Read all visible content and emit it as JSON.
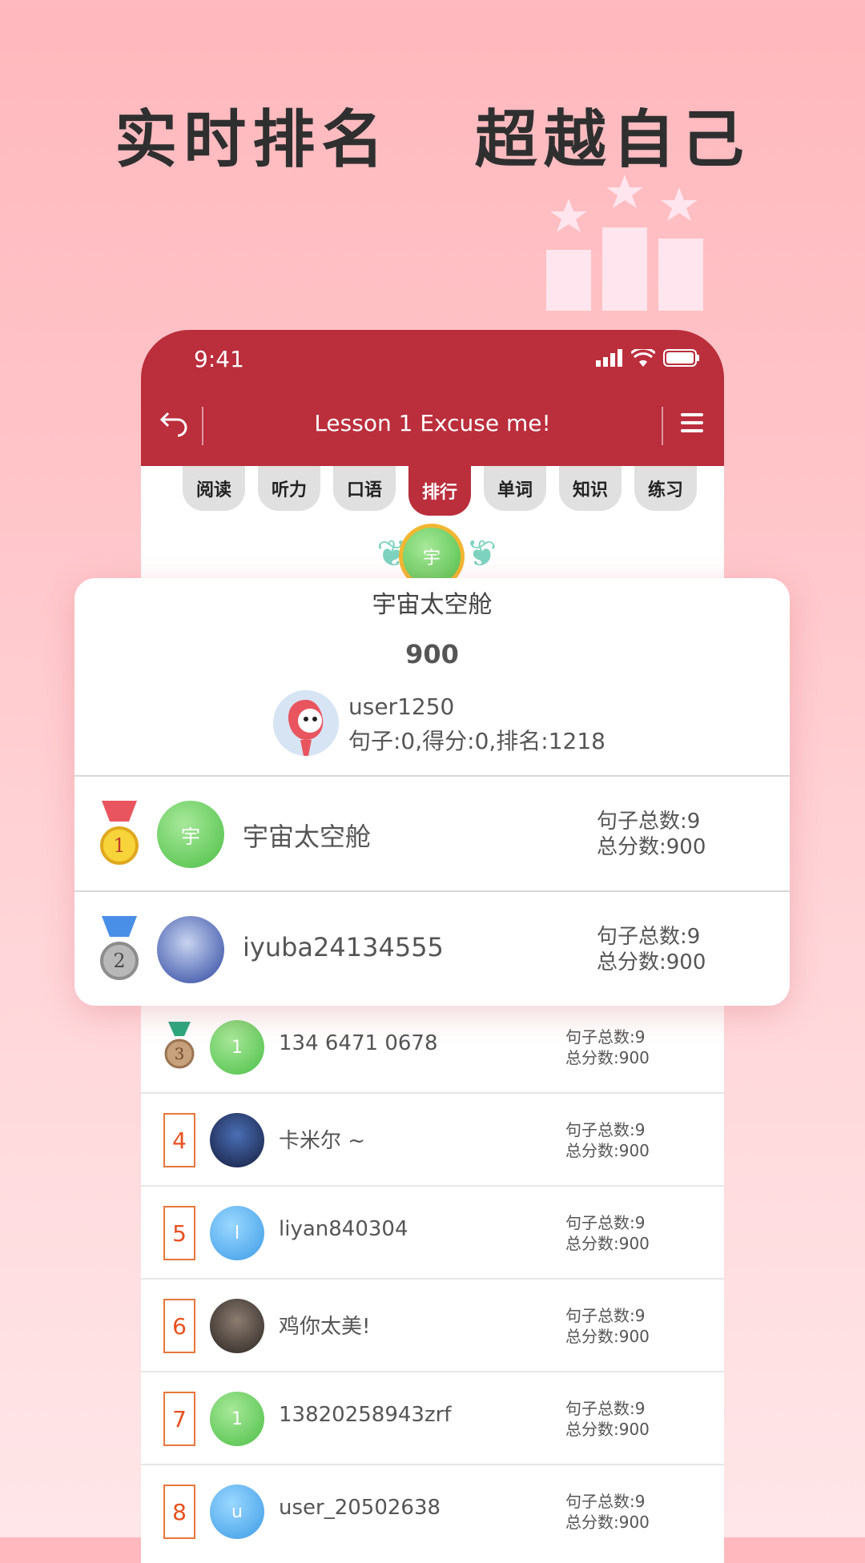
{
  "headline": "实时排名   超越自己",
  "status_bar": {
    "time": "9:41"
  },
  "nav": {
    "title": "Lesson 1 Excuse me!"
  },
  "tabs": [
    "阅读",
    "听力",
    "口语",
    "排行",
    "单词",
    "知识",
    "练习"
  ],
  "active_tab": "排行",
  "top_user": {
    "avatar_letter": "宇"
  },
  "card": {
    "name": "宇宙太空舱",
    "score": "900",
    "me": {
      "name": "user1250",
      "stats": "句子:0,得分:0,排名:1218"
    },
    "rows": [
      {
        "rank": "1",
        "avatar_letter": "宇",
        "name": "宇宙太空舱",
        "sentences": "句子总数:9",
        "total": "总分数:900"
      },
      {
        "rank": "2",
        "avatar_letter": "",
        "name": "iyuba24134555",
        "sentences": "句子总数:9",
        "total": "总分数:900"
      }
    ]
  },
  "list": [
    {
      "rank": "3",
      "avatar_letter": "1",
      "name": "134 6471 0678",
      "sentences": "句子总数:9",
      "total": "总分数:900"
    },
    {
      "rank": "4",
      "avatar_letter": "",
      "name": "卡米尔 ~",
      "sentences": "句子总数:9",
      "total": "总分数:900"
    },
    {
      "rank": "5",
      "avatar_letter": "l",
      "name": "liyan840304",
      "sentences": "句子总数:9",
      "total": "总分数:900"
    },
    {
      "rank": "6",
      "avatar_letter": "",
      "name": "鸡你太美!",
      "sentences": "句子总数:9",
      "total": "总分数:900"
    },
    {
      "rank": "7",
      "avatar_letter": "1",
      "name": "13820258943zrf",
      "sentences": "句子总数:9",
      "total": "总分数:900"
    },
    {
      "rank": "8",
      "avatar_letter": "u",
      "name": "user_20502638",
      "sentences": "句子总数:9",
      "total": "总分数:900"
    }
  ],
  "colors": {
    "brand": "#bb2e3c",
    "rank_text": "#e8501e",
    "gold": "#f2b632"
  },
  "icons": [
    "back-arrow-icon",
    "menu-icon",
    "signal-icon",
    "wifi-icon",
    "battery-icon",
    "gold-medal-icon",
    "silver-medal-icon",
    "bronze-medal-icon",
    "laurel-icon",
    "podium-stars-icon"
  ]
}
